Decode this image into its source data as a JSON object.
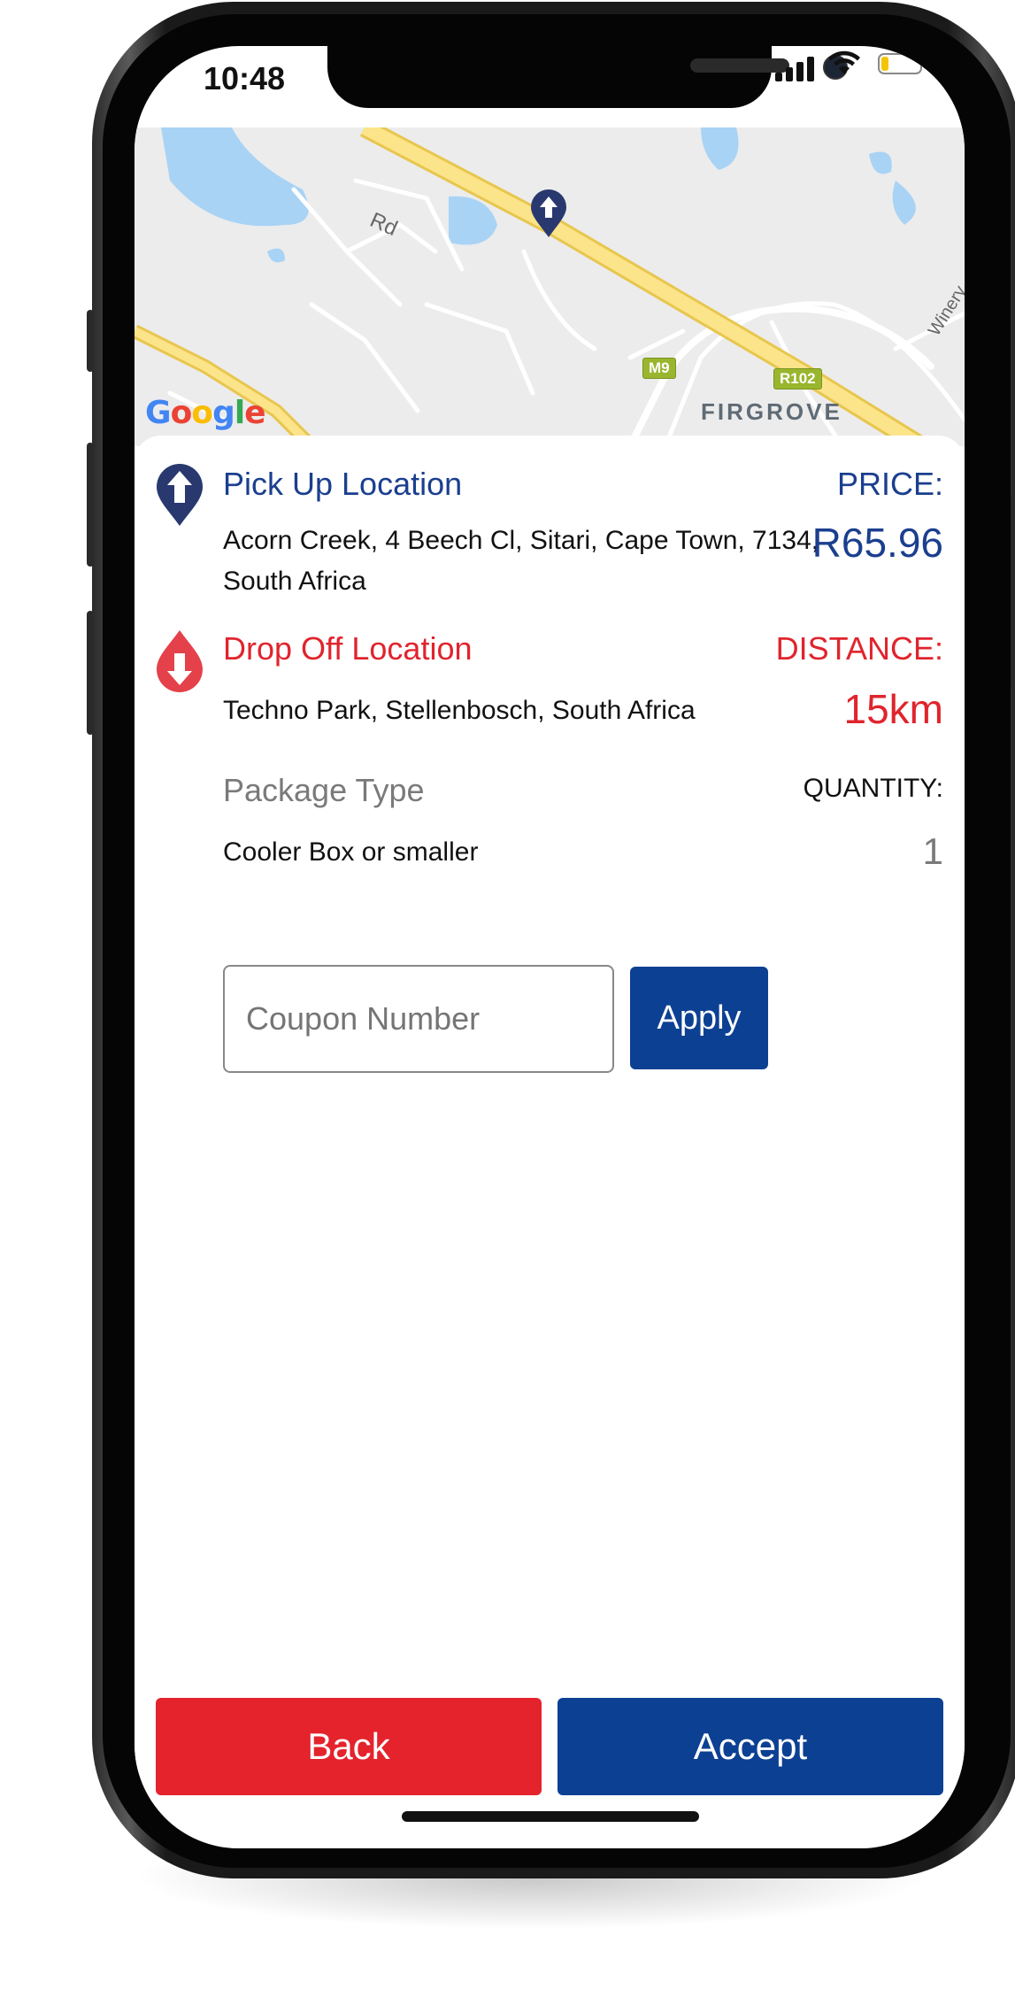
{
  "status_bar": {
    "time": "10:48",
    "battery_level": 0.2
  },
  "map": {
    "logo_text": "Google",
    "labels": {
      "road": "Rd",
      "place": "FIRGROVE",
      "route_m9": "M9",
      "route_r102": "R102",
      "winery": "Winery"
    },
    "pin_icon": "arrow-up-pin-icon"
  },
  "pickup": {
    "title": "Pick Up Location",
    "address_line1": "Acorn Creek, 4 Beech Cl, Sitari, Cape Town, 7134,",
    "address_line2": "South Africa",
    "icon": "arrow-up-pin-icon"
  },
  "price": {
    "label": "PRICE:",
    "value": "R65.96"
  },
  "dropoff": {
    "title": "Drop Off Location",
    "address": "Techno Park, Stellenbosch, South Africa",
    "icon": "arrow-down-pin-icon"
  },
  "distance": {
    "label": "DISTANCE:",
    "value": "15km"
  },
  "package": {
    "label": "Package Type",
    "value": "Cooler Box or smaller"
  },
  "quantity": {
    "label": "QUANTITY:",
    "value": "1"
  },
  "coupon": {
    "placeholder": "Coupon Number",
    "value": "",
    "apply_label": "Apply"
  },
  "actions": {
    "back_label": "Back",
    "accept_label": "Accept"
  },
  "colors": {
    "primary_blue": "#0c4093",
    "accent_red": "#e4232d",
    "text_blue": "#1b3f8f"
  }
}
